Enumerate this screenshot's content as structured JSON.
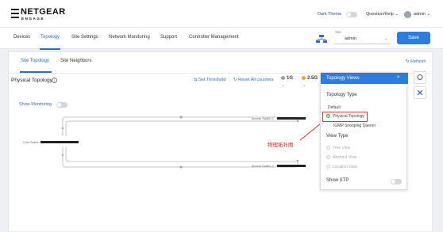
{
  "header": {
    "brand": "NETGEAR",
    "brand_sub": "ENGAGE",
    "dark_theme": "Dark Theme",
    "help": "Question/Help ⌄",
    "user": "admin ⌄"
  },
  "nav": {
    "tabs": [
      "Devices",
      "Topology",
      "Site Settings",
      "Network Monitoring",
      "Support",
      "Controller Management"
    ],
    "active": "Topology",
    "site_label": "Site",
    "site_value": "admin",
    "save": "Save"
  },
  "subtabs": [
    "Site Topology",
    "Site Neighbors"
  ],
  "refresh": "Refresh",
  "toolbar": {
    "title": "Physical Topology",
    "set_threshold": "Set Threshold",
    "reset_counters": "Reset All counters",
    "legend": [
      {
        "label": "1G",
        "color": "#9aa0a6"
      },
      {
        "label": "2.5G",
        "color": "#f5a623"
      }
    ]
  },
  "show_monitoring": "Show Monitoring",
  "switches": {
    "top": "Access Switch 1",
    "core": "Core Switch",
    "bottom": "Access Switch 2"
  },
  "popup": {
    "title": "Topology Views",
    "type_heading": "Topology Type",
    "types": [
      "Default",
      "Physical Topology",
      "IGMP Snooping Querier"
    ],
    "selected_type": "Physical Topology",
    "view_heading": "View Type",
    "views": [
      "Tree View",
      "Abstract View",
      "Location View"
    ],
    "stp": "Show STP"
  },
  "annotation": "物理拓扑图",
  "colors": {
    "accent": "#2b7de0",
    "highlight": "#e0302b",
    "selected": "#2ea44f"
  }
}
